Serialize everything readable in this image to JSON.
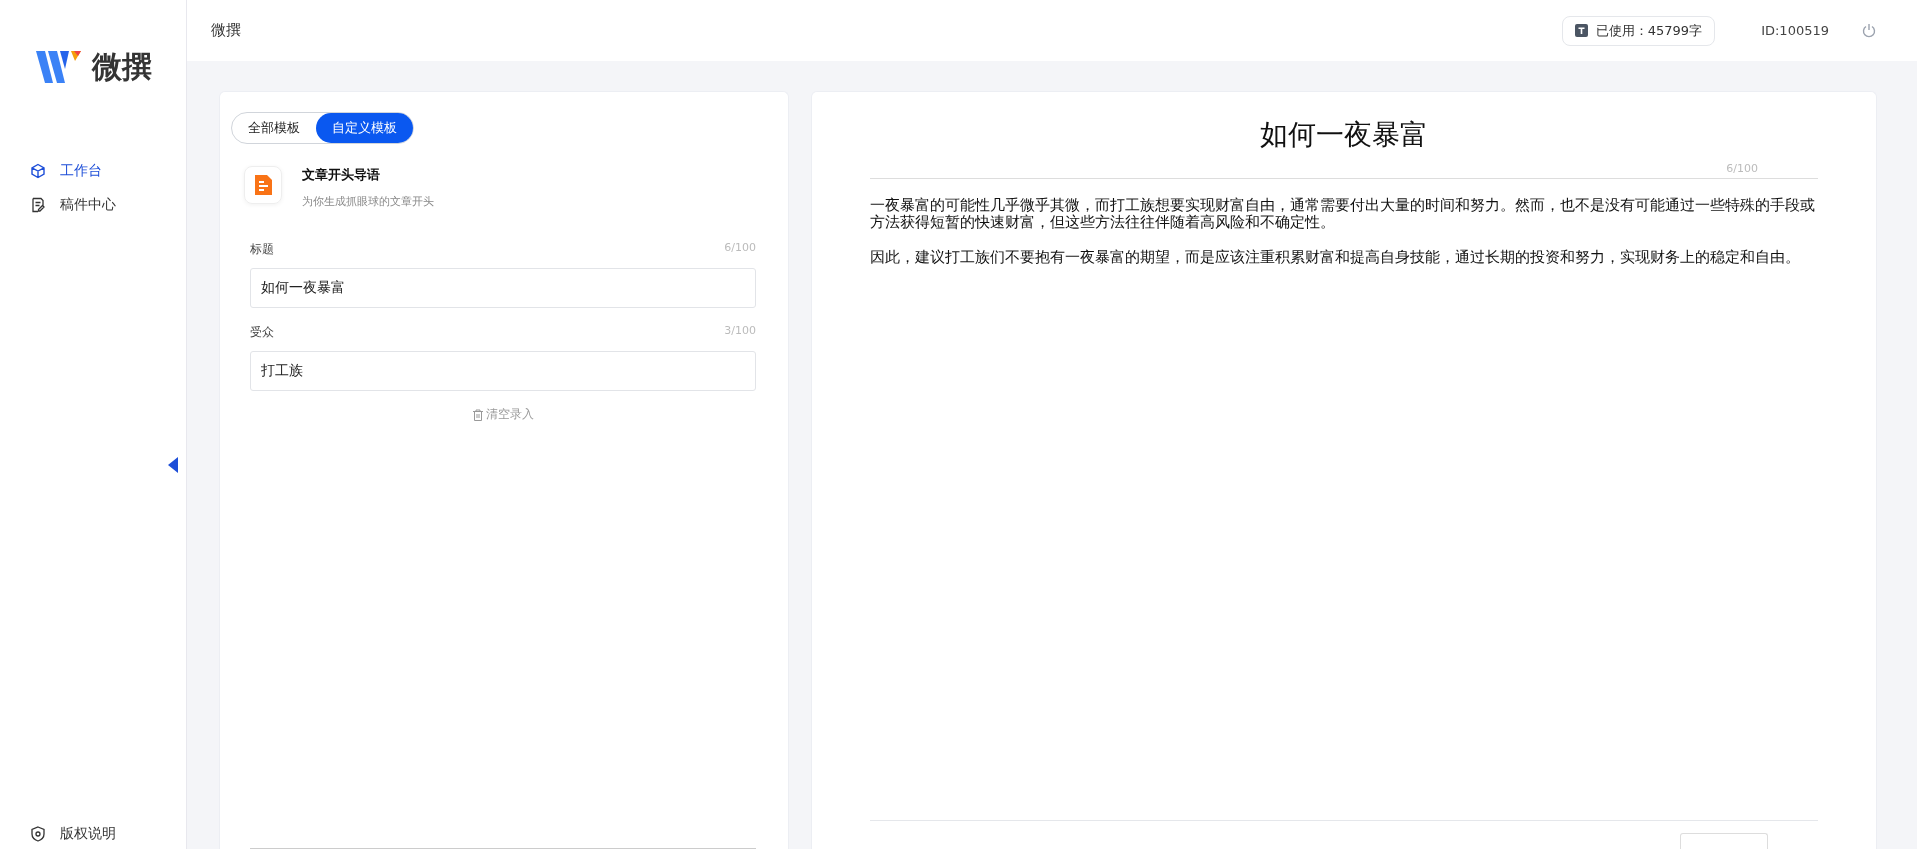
{
  "sidebar": {
    "logo_text": "微撰",
    "items": [
      {
        "label": "工作台",
        "selected": true
      },
      {
        "label": "稿件中心",
        "selected": false
      }
    ],
    "footer_item": "版权说明"
  },
  "header": {
    "title": "微撰",
    "usage": "已使用：45799字",
    "user_id": "ID:100519"
  },
  "template_tabs": [
    {
      "label": "全部模板",
      "selected": false
    },
    {
      "label": "自定义模板",
      "selected": true
    }
  ],
  "template": {
    "name": "文章开头导语",
    "description": "为你生成抓眼球的文章开头"
  },
  "fields": [
    {
      "label": "标题",
      "counter": "6/100",
      "value": "如何一夜暴富"
    },
    {
      "label": "受众",
      "counter": "3/100",
      "value": "打工族"
    }
  ],
  "clear_button": "清空录入",
  "article": {
    "title": "如何一夜暴富",
    "title_counter": "6/100",
    "paragraphs": [
      "一夜暴富的可能性几乎微乎其微，而打工族想要实现财富自由，通常需要付出大量的时间和努力。然而，也不是没有可能通过一些特殊的手段或方法获得短暂的快速财富，但这些方法往往伴随着高风险和不确定性。",
      "因此，建议打工族们不要抱有一夜暴富的期望，而是应该注重积累财富和提高自身技能，通过长期的投资和努力，实现财务上的稳定和自由。"
    ]
  }
}
